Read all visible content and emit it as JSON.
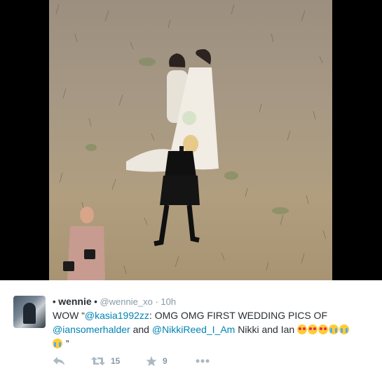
{
  "tweet": {
    "bullet_left": "•",
    "display_name": "wennie",
    "bullet_right": "•",
    "handle": "@wennie_xo",
    "separator": "·",
    "time": "10h",
    "text_parts": {
      "p1": "WOW “",
      "m1": "@kasia1992zz",
      "p2": ": OMG OMG FIRST WEDDING PICS OF",
      "m2": "@iansomerhalder",
      "p3": " and ",
      "m3": "@NikkiReed_I_Am",
      "p4": " Nikki and Ian ",
      "p5": " ”"
    },
    "emojis": [
      "heart-eyes",
      "heart-eyes",
      "heart-eyes",
      "crying",
      "crying",
      "crying"
    ],
    "retweet_count": "15",
    "favorite_count": "9"
  },
  "icons": {
    "reply": "reply-icon",
    "retweet": "retweet-icon",
    "favorite": "star-icon",
    "more": "more-icon"
  },
  "colors": {
    "mention": "#0084b4",
    "meta": "#8899a6",
    "text": "#292f33",
    "action_icon": "#aab8c2"
  }
}
